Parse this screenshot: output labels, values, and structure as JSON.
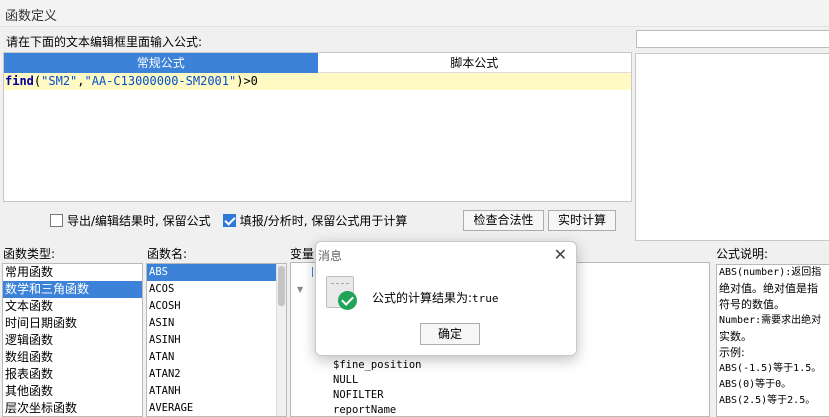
{
  "window": {
    "title": "函数定义"
  },
  "editor": {
    "prompt": "请在下面的文本编辑框里面输入公式:",
    "tabs": [
      {
        "label": "常规公式",
        "active": true
      },
      {
        "label": "脚本公式",
        "active": false
      }
    ],
    "formula": {
      "fn": "find",
      "open": "(",
      "arg1": "\"SM2\"",
      "comma": ",",
      "arg2": "\"AA-C13000000-SM2001\"",
      "rest": ")>0"
    }
  },
  "options": {
    "keep_on_export": {
      "label": "导出/编辑结果时, 保留公式",
      "checked": false
    },
    "keep_on_fill": {
      "label": "填报/分析时, 保留公式用于计算",
      "checked": true
    },
    "check_button": "检查合法性",
    "realtime_button": "实时计算"
  },
  "headers": {
    "func_type": "函数类型:",
    "func_name": "函数名:",
    "variables": "变量",
    "description": "公式说明:"
  },
  "func_types": {
    "selected_index": 1,
    "items": [
      "常用函数",
      "数学和三角函数",
      "文本函数",
      "时间日期函数",
      "逻辑函数",
      "数组函数",
      "报表函数",
      "其他函数",
      "层次坐标函数"
    ]
  },
  "func_names": {
    "selected_index": 0,
    "items": [
      "ABS",
      "ACOS",
      "ACOSH",
      "ASIN",
      "ASINH",
      "ATAN",
      "ATAN2",
      "ATANH",
      "AVERAGE"
    ]
  },
  "variables": {
    "items": [
      "$fine_position",
      "NULL",
      "NOFILTER",
      "reportName"
    ]
  },
  "description": {
    "lines": [
      "ABS(number):返回指",
      "绝对值。绝对值是指",
      "符号的数值。",
      "Number:需要求出绝对",
      "实数。",
      "示例:",
      "ABS(-1.5)等于1.5。",
      "ABS(0)等于0。",
      "ABS(2.5)等于2.5。"
    ]
  },
  "dialog": {
    "title": "消息",
    "message": "公式的计算结果为:",
    "result": "true",
    "ok_label": "确定"
  },
  "colors": {
    "accent": "#3c82d8",
    "formula_bg": "#fff9c4",
    "success": "#22a35a"
  }
}
